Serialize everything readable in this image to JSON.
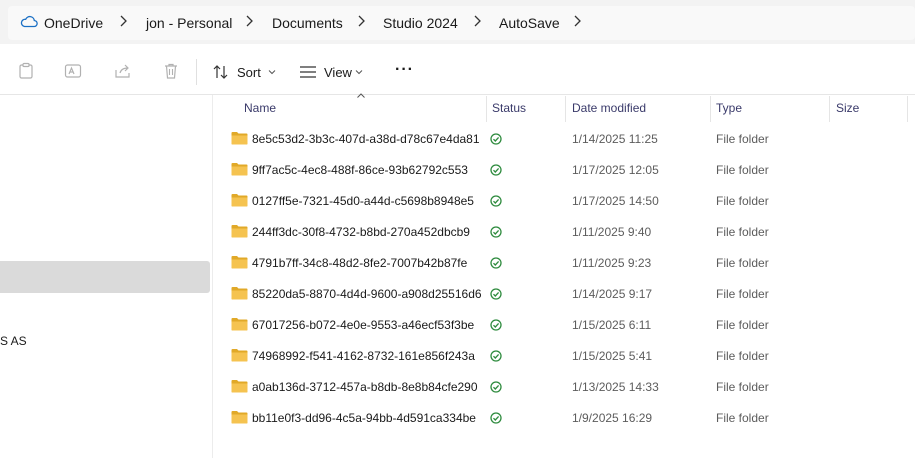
{
  "breadcrumb": {
    "items": [
      "OneDrive",
      "jon - Personal",
      "Documents",
      "Studio 2024",
      "AutoSave"
    ]
  },
  "toolbar": {
    "sort_label": "Sort",
    "view_label": "View",
    "more_label": "···"
  },
  "columns": {
    "name": "Name",
    "status": "Status",
    "date": "Date modified",
    "type": "Type",
    "size": "Size"
  },
  "left_pane": {
    "partial_label": "S AS"
  },
  "rows": [
    {
      "name": "8e5c53d2-3b3c-407d-a38d-d78c67e4da81",
      "date": "1/14/2025 11:25",
      "type": "File folder"
    },
    {
      "name": "9ff7ac5c-4ec8-488f-86ce-93b62792c553",
      "date": "1/17/2025 12:05",
      "type": "File folder"
    },
    {
      "name": "0127ff5e-7321-45d0-a44d-c5698b8948e5",
      "date": "1/17/2025 14:50",
      "type": "File folder"
    },
    {
      "name": "244ff3dc-30f8-4732-b8bd-270a452dbcb9",
      "date": "1/11/2025 9:40",
      "type": "File folder"
    },
    {
      "name": "4791b7ff-34c8-48d2-8fe2-7007b42b87fe",
      "date": "1/11/2025 9:23",
      "type": "File folder"
    },
    {
      "name": "85220da5-8870-4d4d-9600-a908d25516d6",
      "date": "1/14/2025 9:17",
      "type": "File folder"
    },
    {
      "name": "67017256-b072-4e0e-9553-a46ecf53f3be",
      "date": "1/15/2025 6:11",
      "type": "File folder"
    },
    {
      "name": "74968992-f541-4162-8732-161e856f243a",
      "date": "1/15/2025 5:41",
      "type": "File folder"
    },
    {
      "name": "a0ab136d-3712-457a-b8db-8e8b84cfe290",
      "date": "1/13/2025 14:33",
      "type": "File folder"
    },
    {
      "name": "bb11e0f3-dd96-4c5a-94bb-4d591ca334be",
      "date": "1/9/2025 16:29",
      "type": "File folder"
    }
  ],
  "colors": {
    "folder": "#f5c350",
    "folder_dark": "#e1a928",
    "status_ok": "#2e8b3e",
    "cloud": "#1a6fc4"
  }
}
